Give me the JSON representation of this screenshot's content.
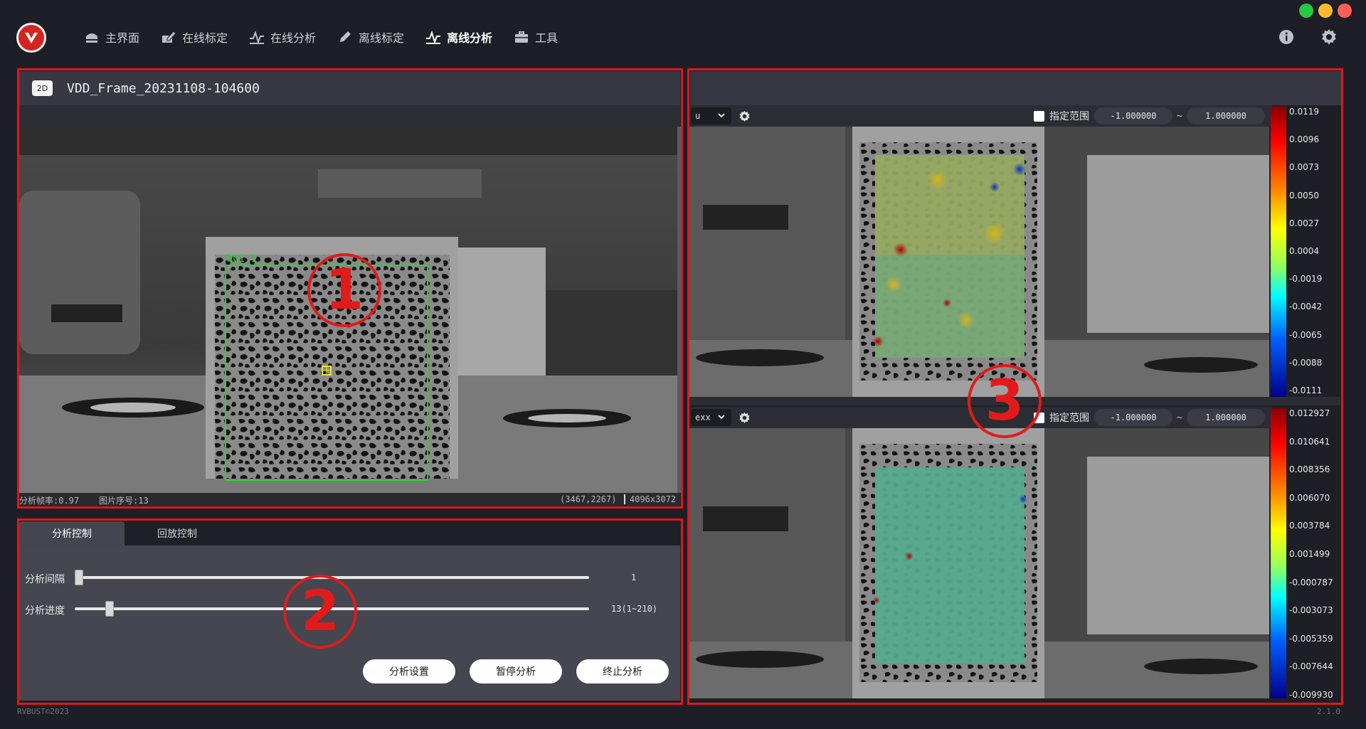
{
  "app": {
    "nav": [
      {
        "label": "主界面",
        "icon": "home-icon",
        "active": false
      },
      {
        "label": "在线标定",
        "icon": "pen-icon",
        "active": false
      },
      {
        "label": "在线分析",
        "icon": "pulse-icon",
        "active": false
      },
      {
        "label": "离线标定",
        "icon": "pencil-icon",
        "active": false
      },
      {
        "label": "离线分析",
        "icon": "pulse-icon",
        "active": true
      },
      {
        "label": "工具",
        "icon": "toolbox-icon",
        "active": false
      }
    ],
    "traffic_colors": [
      "#28c840",
      "#febc2e",
      "#ff5f57"
    ],
    "accent": "#e1161c"
  },
  "left_panel": {
    "badge": "2D",
    "frame_title": "VDD_Frame_20231108-104600",
    "roi_label": "ROI_1",
    "status": {
      "rate": "分析帧率:0.97",
      "index": "图片序号:13",
      "coord": "(3467,2267)",
      "resolution": "4096x3072"
    }
  },
  "control_panel": {
    "tabs": [
      "分析控制",
      "回放控制"
    ],
    "active_tab": 0,
    "interval": {
      "label": "分析间隔",
      "value": "1",
      "position": 0.0
    },
    "progress": {
      "label": "分析进度",
      "value": "13(1~210)",
      "position": 0.06
    },
    "buttons": {
      "settings": "分析设置",
      "pause": "暂停分析",
      "stop": "终止分析"
    }
  },
  "right_panel": {
    "views": [
      {
        "field": "u",
        "range_label": "指定范围",
        "range_checked": false,
        "range_min": "-1.000000",
        "range_max": "1.000000",
        "tilde": "~",
        "colorbar_ticks": [
          "0.0119",
          "0.0096",
          "0.0073",
          "0.0050",
          "0.0027",
          "0.0004",
          "-0.0019",
          "-0.0042",
          "-0.0065",
          "-0.0088",
          "-0.0111"
        ]
      },
      {
        "field": "exx",
        "range_label": "指定范围",
        "range_checked": false,
        "range_min": "-1.000000",
        "range_max": "1.000000",
        "tilde": "~",
        "colorbar_ticks": [
          "0.012927",
          "0.010641",
          "0.008356",
          "0.006070",
          "0.003784",
          "0.001499",
          "-0.000787",
          "-0.003073",
          "-0.005359",
          "-0.007644",
          "-0.009930"
        ]
      }
    ]
  },
  "annotations": [
    "1",
    "2",
    "3"
  ],
  "footer": {
    "left": "RVBUST©2023",
    "right": "2.1.0"
  }
}
